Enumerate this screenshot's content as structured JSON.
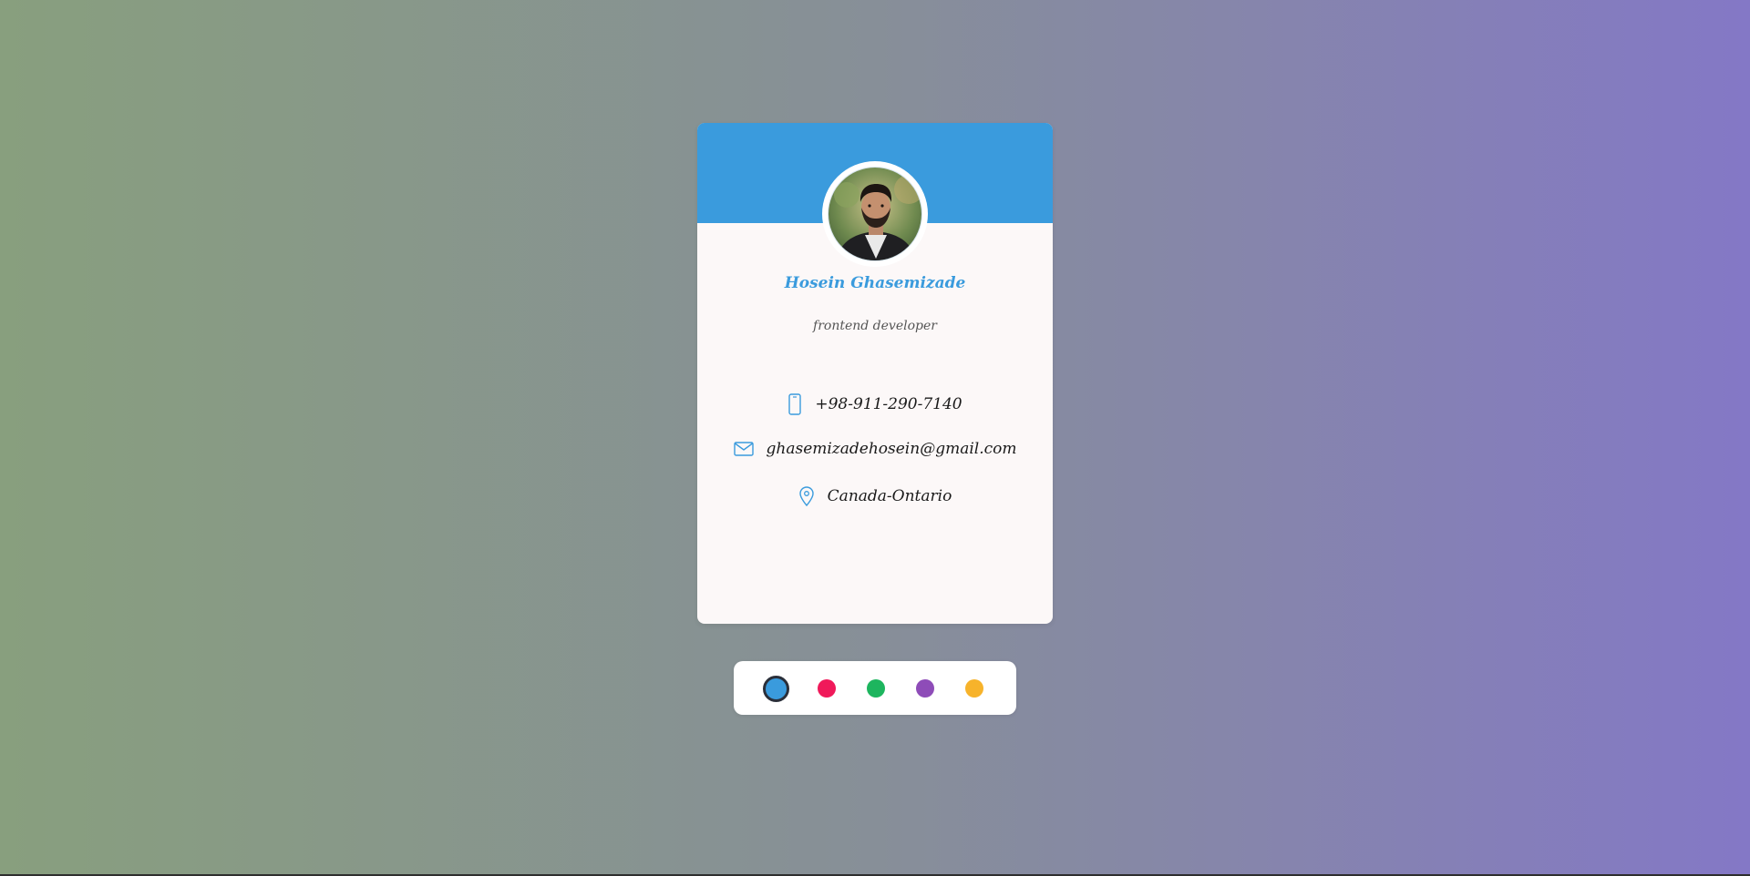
{
  "profile": {
    "name": "Hosein Ghasemizade",
    "role": "frontend developer",
    "photo_alt": "profile-photo"
  },
  "contacts": {
    "phone": {
      "icon": "phone-icon",
      "text": "+98-911-290-7140"
    },
    "email": {
      "icon": "mail-icon",
      "text": "ghasemizadehosein@gmail.com"
    },
    "location": {
      "icon": "map-pin-icon",
      "text": "Canada-Ontario"
    }
  },
  "theme": {
    "accent": "#3a9bdd",
    "swatches": [
      {
        "name": "blue",
        "color": "#3a9bdd",
        "selected": true
      },
      {
        "name": "pink",
        "color": "#f0195a",
        "selected": false
      },
      {
        "name": "green",
        "color": "#1db55e",
        "selected": false
      },
      {
        "name": "purple",
        "color": "#8e4cb8",
        "selected": false
      },
      {
        "name": "yellow",
        "color": "#f7b32b",
        "selected": false
      }
    ]
  }
}
